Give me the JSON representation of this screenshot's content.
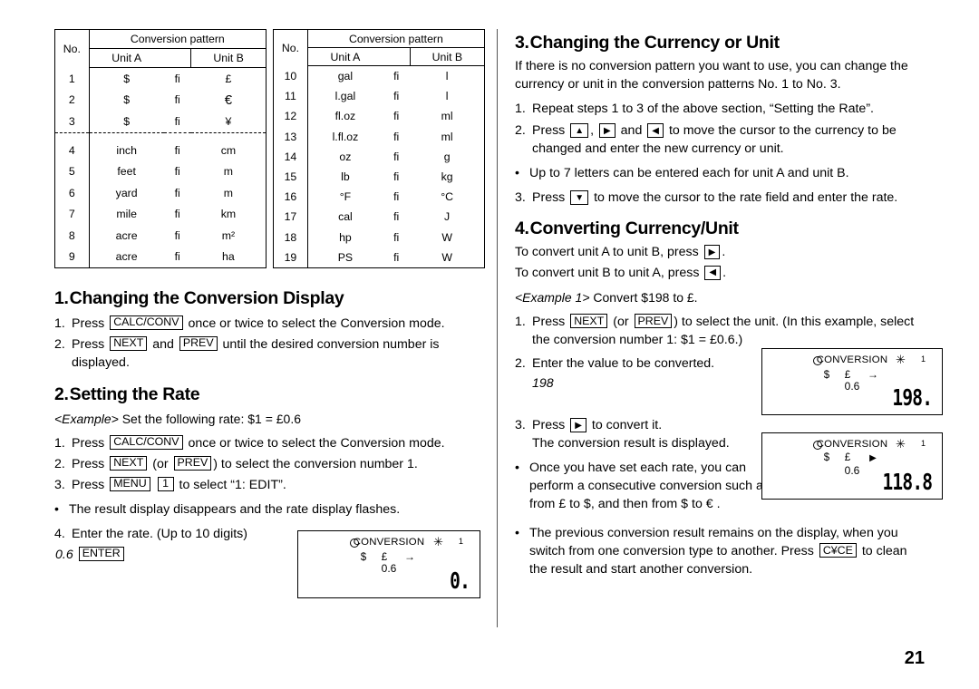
{
  "table": {
    "headers": {
      "no": "No.",
      "conversion_pattern": "Conversion pattern",
      "unit_a": "Unit A",
      "unit_b": "Unit B"
    },
    "arrow": "fi",
    "left_rows": [
      {
        "no": "1",
        "unit_a": "$",
        "unit_b": "£"
      },
      {
        "no": "2",
        "unit_a": "$",
        "unit_b": "€"
      },
      {
        "no": "3",
        "unit_a": "$",
        "unit_b": "¥"
      },
      {
        "no": "4",
        "unit_a": "inch",
        "unit_b": "cm"
      },
      {
        "no": "5",
        "unit_a": "feet",
        "unit_b": "m"
      },
      {
        "no": "6",
        "unit_a": "yard",
        "unit_b": "m"
      },
      {
        "no": "7",
        "unit_a": "mile",
        "unit_b": "km"
      },
      {
        "no": "8",
        "unit_a": "acre",
        "unit_b": "m²"
      },
      {
        "no": "9",
        "unit_a": "acre",
        "unit_b": "ha"
      }
    ],
    "right_rows": [
      {
        "no": "10",
        "unit_a": "gal",
        "unit_b": "l"
      },
      {
        "no": "11",
        "unit_a": "l.gal",
        "unit_b": "l"
      },
      {
        "no": "12",
        "unit_a": "fl.oz",
        "unit_b": "ml"
      },
      {
        "no": "13",
        "unit_a": "l.fl.oz",
        "unit_b": "ml"
      },
      {
        "no": "14",
        "unit_a": "oz",
        "unit_b": "g"
      },
      {
        "no": "15",
        "unit_a": "lb",
        "unit_b": "kg"
      },
      {
        "no": "16",
        "unit_a": "°F",
        "unit_b": "°C"
      },
      {
        "no": "17",
        "unit_a": "cal",
        "unit_b": "J"
      },
      {
        "no": "18",
        "unit_a": "hp",
        "unit_b": "W"
      },
      {
        "no": "19",
        "unit_a": "PS",
        "unit_b": "W"
      }
    ]
  },
  "section1": {
    "number": "1.",
    "title": "Changing the Conversion Display",
    "step1": {
      "marker": "1.",
      "pre": "Press",
      "key": "CALC/CONV",
      "post": "once or twice to select the Conversion mode."
    },
    "step2": {
      "marker": "2.",
      "pre": "Press",
      "key1": "NEXT",
      "mid": "and",
      "key2": "PREV",
      "post": "until the desired conversion number is displayed."
    }
  },
  "section2": {
    "number": "2.",
    "title": "Setting the Rate",
    "example_label": "<Example>",
    "example_text": "Set the following rate: $1 = £0.6",
    "step1": {
      "marker": "1.",
      "pre": "Press",
      "key": "CALC/CONV",
      "post": "once or twice to select the Conversion mode."
    },
    "step2": {
      "marker": "2.",
      "pre": "Press",
      "key1": "NEXT",
      "mid": "(or",
      "key2": "PREV",
      "post": ") to select the conversion number 1."
    },
    "step3": {
      "marker": "3.",
      "pre": "Press",
      "key1": "MENU",
      "key2": "1",
      "post": "to select “1: EDIT”."
    },
    "bullet1": {
      "marker": "•",
      "text": "The result display disappears and the rate display flashes."
    },
    "step4": {
      "marker": "4.",
      "text": "Enter the rate. (Up to 10 digits)"
    },
    "entry_value": "0.6",
    "entry_key": "ENTER"
  },
  "lcd1": {
    "title": "CONVERSION",
    "star": "✳",
    "number": "1",
    "unit_a": "$",
    "unit_b": "£",
    "arrow": "→",
    "rate": "0.6",
    "result": "0."
  },
  "section3": {
    "number": "3.",
    "title": "Changing the Currency or Unit",
    "intro": "If there is no conversion pattern you want to use, you can change the currency or unit in the conversion patterns No. 1 to No. 3.",
    "step1": {
      "marker": "1.",
      "text": "Repeat steps 1 to 3 of the above section, “Setting the Rate”."
    },
    "step2": {
      "marker": "2.",
      "pre": "Press",
      "key_up": "▲",
      "key_right": "▶",
      "mid": "and",
      "key_left": "◀",
      "post": "to move the cursor to the currency to be changed and enter the new currency or unit."
    },
    "bullet1": {
      "marker": "•",
      "text": "Up to 7 letters can be entered each for unit A and unit B."
    },
    "step3": {
      "marker": "3.",
      "pre": "Press",
      "key_down": "▼",
      "post": "to move the cursor to the rate field and enter the rate."
    }
  },
  "section4": {
    "number": "4.",
    "title": "Converting Currency/Unit",
    "line1_pre": "To convert unit A to unit B, press",
    "line1_key": "▶",
    "line1_post": ".",
    "line2_pre": "To convert unit B to unit A, press",
    "line2_key": "◀",
    "line2_post": ".",
    "example_label": "<Example 1>",
    "example_text": "Convert $198 to £.",
    "step1": {
      "marker": "1.",
      "pre": "Press",
      "key1": "NEXT",
      "mid": "(or",
      "key2": "PREV",
      "post": ") to select the unit. (In this example, select the conversion number 1: $1 = £0.6.)"
    },
    "step2": {
      "marker": "2.",
      "text": "Enter the value to be converted."
    },
    "entry_value": "198",
    "step3": {
      "marker": "3.",
      "pre": "Press",
      "key": "▶",
      "post": "to convert it.",
      "line2": "The conversion result is displayed."
    },
    "bullet1": {
      "marker": "•",
      "text": "Once you have set each rate, you can perform a consecutive conversion such as from £ to $, and then from $ to € ."
    },
    "bullet2": {
      "marker": "•",
      "pre": "The previous conversion result remains on the display, when you switch from one conversion type to another. Press",
      "key": "C¥CE",
      "post": "to clean the result and start another conversion."
    }
  },
  "lcd2": {
    "title": "CONVERSION",
    "star": "✳",
    "number": "1",
    "unit_a": "$",
    "unit_b": "£",
    "arrow": "→",
    "rate": "0.6",
    "result": "198."
  },
  "lcd3": {
    "title": "CONVERSION",
    "star": "✳",
    "number": "1",
    "unit_a": "$",
    "unit_b": "£",
    "arrow": "▶",
    "rate": "0.6",
    "result": "118.8"
  },
  "footer": {
    "page_number": "21"
  }
}
